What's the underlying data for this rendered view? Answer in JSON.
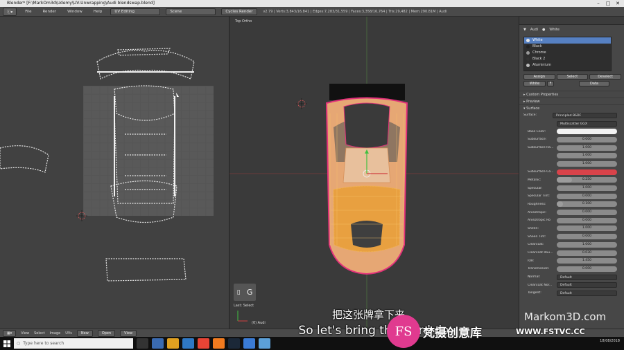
{
  "window": {
    "title": "Blender* [F:\\MarkOm3d\\Udemy\\UV-Unwrapping\\Audi blendswap.blend]"
  },
  "menubar": {
    "items": [
      "File",
      "Render",
      "Window",
      "Help"
    ],
    "layout": "UV Editing",
    "scene": "Scene",
    "engine": "Cycles Render",
    "stats": "v2.79 | Verts:3,843/16,841 | Edges:7,283/31,559 | Faces:3,358/16,764 | Tris:29,482 | Mem:290.81M | Audi"
  },
  "viewport": {
    "label": "Top Ortho",
    "hint_key": "G",
    "last_op": "Last: Select",
    "object_label": "(0) Audi"
  },
  "uv_bottombar": {
    "items": [
      "View",
      "Select",
      "Image",
      "UVs"
    ],
    "new_label": "New",
    "open_label": "Open",
    "view_label": "View"
  },
  "properties": {
    "object": "Audi",
    "material": "White",
    "materials": [
      {
        "name": "White",
        "color": "#e6e6e6",
        "active": true
      },
      {
        "name": "Black",
        "color": "#222222",
        "active": false
      },
      {
        "name": "Chrome",
        "color": "#9a9a9a",
        "active": false
      },
      {
        "name": "Black 2",
        "color": "#333333",
        "active": false
      },
      {
        "name": "Aluminium",
        "color": "#bdbdbd",
        "active": false
      }
    ],
    "assign": "Assign",
    "select": "Select",
    "deselect": "Deselect",
    "data_name": "White",
    "data_f": "F",
    "data_label": "Data",
    "sections": {
      "custom": "Custom Properties",
      "preview": "Preview",
      "surface": "Surface"
    },
    "surface_label": "Surface:",
    "surface_value": "Principled BSDF",
    "distribution": "Multiscatter GGX",
    "base_color_label": "Base Color:",
    "base_color": "#f2f2f2",
    "subsurface_color": "#d9434a",
    "params": [
      {
        "label": "Subsurface:",
        "value": "0.000",
        "fill": 0
      },
      {
        "label": "Subsurface Ra...",
        "value": "1.000",
        "fill": 0
      },
      {
        "label": "",
        "value": "1.000",
        "fill": 0
      },
      {
        "label": "",
        "value": "1.000",
        "fill": 0
      },
      {
        "label": "Subsurface Co...",
        "value": "",
        "fill": 0
      },
      {
        "label": "Metallic:",
        "value": "0.250",
        "fill": 0.25
      },
      {
        "label": "Specular:",
        "value": "1.000",
        "fill": 0
      },
      {
        "label": "Specular Tint:",
        "value": "0.000",
        "fill": 0
      },
      {
        "label": "Roughness:",
        "value": "0.100",
        "fill": 0.1
      },
      {
        "label": "Anisotropic:",
        "value": "0.000",
        "fill": 0
      },
      {
        "label": "Anisotropic Ro",
        "value": "0.000",
        "fill": 0
      },
      {
        "label": "Sheen:",
        "value": "1.000",
        "fill": 0
      },
      {
        "label": "Sheen Tint:",
        "value": "0.000",
        "fill": 0
      },
      {
        "label": "Clearcoat:",
        "value": "1.000",
        "fill": 0
      },
      {
        "label": "Clearcoat Rou...",
        "value": "0.030",
        "fill": 0
      },
      {
        "label": "IOR:",
        "value": "1.450",
        "fill": 0
      },
      {
        "label": "Transmission:",
        "value": "0.000",
        "fill": 0
      }
    ],
    "normal_label": "Normal:",
    "normal_value": "Default",
    "clearcoat_normal_label": "Clearcoat Nor...",
    "clearcoat_normal_value": "Default",
    "tangent_label": "Tangent:",
    "tangent_value": "Default"
  },
  "overlay": {
    "subtitle_cn": "把这张牌拿下来。",
    "subtitle_en": "So let's bring this card do",
    "watermark": "Markom3D.com",
    "logo_letters": "FS",
    "logo_cn": "梵摄创意库",
    "logo_url": "WWW.FSTVC.CC"
  },
  "taskbar": {
    "search_placeholder": "Type here to search",
    "date": "18/08/2018"
  }
}
